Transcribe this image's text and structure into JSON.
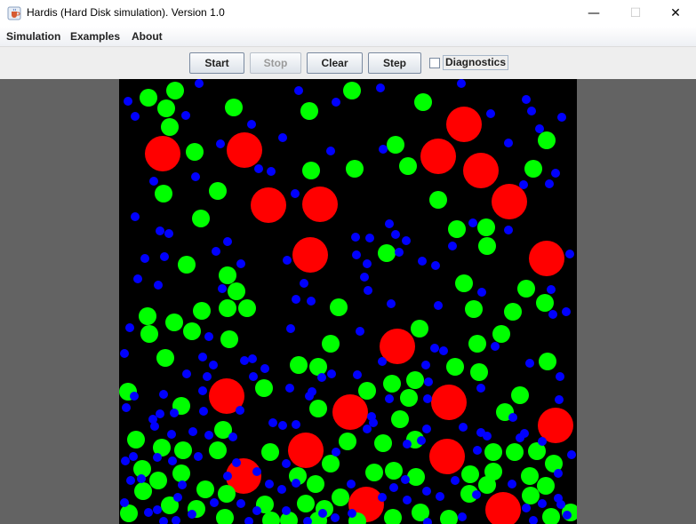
{
  "window": {
    "title": "Hardis (Hard Disk simulation). Version 1.0",
    "app_icon": "java-cup-icon",
    "minimize_glyph": "—",
    "maximize_glyph": "☐",
    "close_glyph": "✕"
  },
  "menu": {
    "simulation": "Simulation",
    "examples": "Examples",
    "about": "About"
  },
  "toolbar": {
    "start": "Start",
    "stop": "Stop",
    "clear": "Clear",
    "step": "Step",
    "diagnostics": "Diagnostics",
    "diagnostics_checked": false
  },
  "colors": {
    "large_disk": "#ff0000",
    "medium_disk": "#00ff00",
    "small_disk": "#0000ff",
    "sim_background": "#000000",
    "surround": "#636363"
  },
  "disk_types": [
    "large red disks",
    "medium green disks",
    "small blue disks"
  ]
}
